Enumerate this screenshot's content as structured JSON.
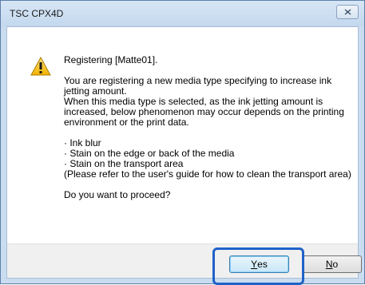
{
  "window": {
    "title": "TSC CPX4D"
  },
  "message": {
    "line1": "Registering [Matte01].",
    "para2": [
      "You are registering a new media type specifying to increase ink",
      "jetting amount.",
      "When this media type is selected, as the ink jetting amount is",
      "increased, below phenomenon may occur depends on the printing",
      "environment or the print data."
    ],
    "bullets": [
      "· Ink blur",
      "· Stain on the edge or back of the media",
      "· Stain on the transport area"
    ],
    "note": "(Please refer to the user's guide for how to clean the transport area)",
    "question": "Do you want to proceed?"
  },
  "buttons": {
    "yes_mnemonic": "Y",
    "yes_rest": "es",
    "no_mnemonic": "N",
    "no_rest": "o"
  },
  "icons": {
    "warning": "warning-icon",
    "close": "close-icon"
  }
}
